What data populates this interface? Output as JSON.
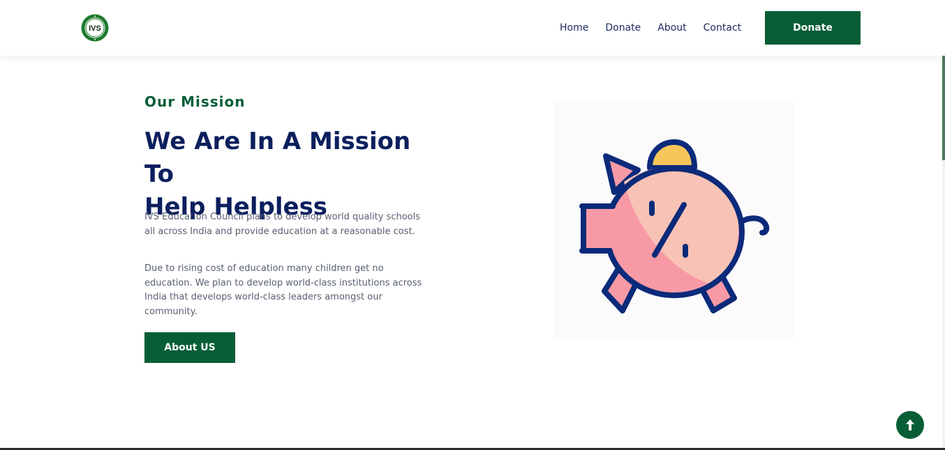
{
  "header": {
    "logo_text": "IVS",
    "nav": [
      {
        "label": "Home"
      },
      {
        "label": "Donate"
      },
      {
        "label": "About"
      },
      {
        "label": "Contact"
      }
    ],
    "donate_button": "Donate"
  },
  "mission": {
    "eyebrow": "Our Mission",
    "title_line1": "We Are In A Mission To",
    "title_line2": "Help Helpless",
    "paragraph1": "IVS Education Council plans to develop world quality schools all across India and provide education at a reasonable cost.",
    "paragraph2": "Due to rising cost of education many children get no education. We plan to develop world-class institutions across India that develops world-class leaders amongst our community.",
    "about_button": "About US"
  },
  "illustration": {
    "icon": "piggy-bank-percent-icon"
  },
  "back_to_top": {
    "icon": "arrow-up-icon"
  },
  "colors": {
    "brand_green": "#075e36",
    "navy": "#0b1f5e",
    "piggy_pink": "#f89aa5",
    "piggy_light": "#f8c3b5",
    "coin_yellow": "#f7c65a"
  }
}
